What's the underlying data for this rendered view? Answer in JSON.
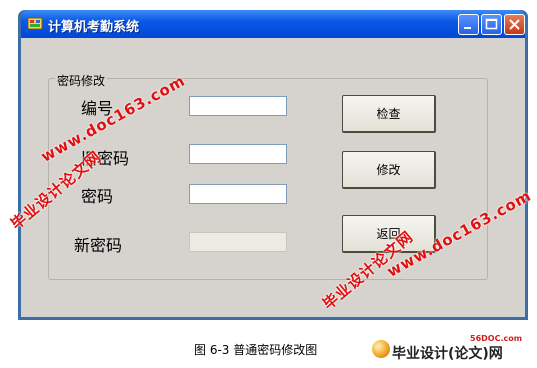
{
  "window": {
    "title": "计算机考勤系统"
  },
  "group": {
    "caption": "密码修改"
  },
  "labels": {
    "id": "编号",
    "old_password": "旧密码",
    "password": "密码",
    "new_password": "新密码"
  },
  "buttons": {
    "check": "检查",
    "modify": "修改",
    "back": "返回"
  },
  "figure_caption": "图  6-3  普通密码修改图",
  "watermarks": {
    "site": "www.doc163.com",
    "brand": "毕业设计论文网"
  },
  "footer_logo": {
    "small": "56DOC.com",
    "main": "毕业设计(论文)网"
  },
  "colors": {
    "titlebar": "#0a58e6",
    "client": "#d6d3ce",
    "watermark": "#e01010",
    "close": "#c4391b"
  }
}
